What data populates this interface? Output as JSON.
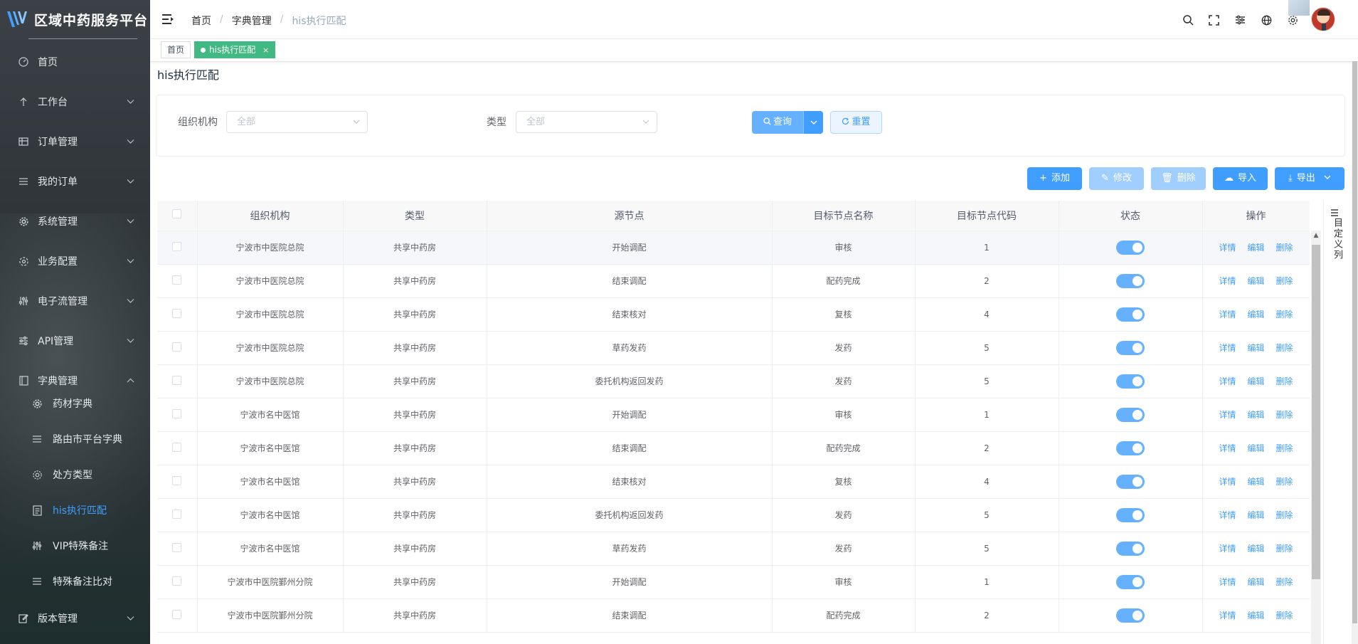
{
  "app": {
    "title": "区域中药服务平台"
  },
  "sidebar": {
    "items": [
      {
        "label": "首页",
        "icon": "dashboard-icon",
        "expandable": false
      },
      {
        "label": "工作台",
        "icon": "arrow-up-icon",
        "expandable": true
      },
      {
        "label": "订单管理",
        "icon": "table-icon",
        "expandable": true
      },
      {
        "label": "我的订单",
        "icon": "list-icon",
        "expandable": true
      },
      {
        "label": "系统管理",
        "icon": "gear-icon",
        "expandable": true
      },
      {
        "label": "业务配置",
        "icon": "settings-icon",
        "expandable": true
      },
      {
        "label": "电子流管理",
        "icon": "sliders-icon",
        "expandable": true
      },
      {
        "label": "API管理",
        "icon": "sliders-h-icon",
        "expandable": true
      },
      {
        "label": "字典管理",
        "icon": "dict-icon",
        "expandable": true,
        "expanded": true
      },
      {
        "label": "版本管理",
        "icon": "edit-icon",
        "expandable": true
      }
    ],
    "dict_children": [
      {
        "label": "药材字典",
        "icon": "gear-icon"
      },
      {
        "label": "路由市平台字典",
        "icon": "list-icon"
      },
      {
        "label": "处方类型",
        "icon": "gear-outline-icon"
      },
      {
        "label": "his执行匹配",
        "icon": "document-icon",
        "active": true
      },
      {
        "label": "VIP特殊备注",
        "icon": "sliders-icon"
      },
      {
        "label": "特殊备注比对",
        "icon": "list-icon"
      }
    ]
  },
  "header": {
    "breadcrumb": [
      "首页",
      "字典管理",
      "his执行匹配"
    ],
    "separator": "/"
  },
  "tags": [
    {
      "label": "首页",
      "active": false
    },
    {
      "label": "his执行匹配",
      "active": true,
      "close": "×"
    }
  ],
  "page": {
    "title": "his执行匹配",
    "filters": {
      "org_label": "组织机构",
      "org_placeholder": "全部",
      "type_label": "类型",
      "type_placeholder": "全部",
      "query_label": "查询",
      "reset_label": "重置"
    },
    "toolbar": {
      "add": "添加",
      "edit": "修改",
      "delete": "删除",
      "import": "导入",
      "export": "导出"
    },
    "custom_columns": "目定义列"
  },
  "table": {
    "columns": [
      "组织机构",
      "类型",
      "源节点",
      "目标节点名称",
      "目标节点代码",
      "状态",
      "操作"
    ],
    "actions": [
      "详情",
      "编辑",
      "删除"
    ],
    "rows": [
      {
        "org": "宁波市中医院总院",
        "type": "共享中药房",
        "source": "开始调配",
        "target_name": "审核",
        "target_code": "1",
        "enabled": true
      },
      {
        "org": "宁波市中医院总院",
        "type": "共享中药房",
        "source": "结束调配",
        "target_name": "配药完成",
        "target_code": "2",
        "enabled": true
      },
      {
        "org": "宁波市中医院总院",
        "type": "共享中药房",
        "source": "结束核对",
        "target_name": "复核",
        "target_code": "4",
        "enabled": true
      },
      {
        "org": "宁波市中医院总院",
        "type": "共享中药房",
        "source": "草药发药",
        "target_name": "发药",
        "target_code": "5",
        "enabled": true
      },
      {
        "org": "宁波市中医院总院",
        "type": "共享中药房",
        "source": "委托机构返回发药",
        "target_name": "发药",
        "target_code": "5",
        "enabled": true
      },
      {
        "org": "宁波市名中医馆",
        "type": "共享中药房",
        "source": "开始调配",
        "target_name": "审核",
        "target_code": "1",
        "enabled": true
      },
      {
        "org": "宁波市名中医馆",
        "type": "共享中药房",
        "source": "结束调配",
        "target_name": "配药完成",
        "target_code": "2",
        "enabled": true
      },
      {
        "org": "宁波市名中医馆",
        "type": "共享中药房",
        "source": "结束核对",
        "target_name": "复核",
        "target_code": "4",
        "enabled": true
      },
      {
        "org": "宁波市名中医馆",
        "type": "共享中药房",
        "source": "委托机构返回发药",
        "target_name": "发药",
        "target_code": "5",
        "enabled": true
      },
      {
        "org": "宁波市名中医馆",
        "type": "共享中药房",
        "source": "草药发药",
        "target_name": "发药",
        "target_code": "5",
        "enabled": true
      },
      {
        "org": "宁波市中医院鄞州分院",
        "type": "共享中药房",
        "source": "开始调配",
        "target_name": "审核",
        "target_code": "1",
        "enabled": true
      },
      {
        "org": "宁波市中医院鄞州分院",
        "type": "共享中药房",
        "source": "结束调配",
        "target_name": "配药完成",
        "target_code": "2",
        "enabled": true
      }
    ]
  },
  "colors": {
    "primary": "#409eff",
    "tag_active": "#42b983",
    "sidebar_bg": "#30373a"
  }
}
